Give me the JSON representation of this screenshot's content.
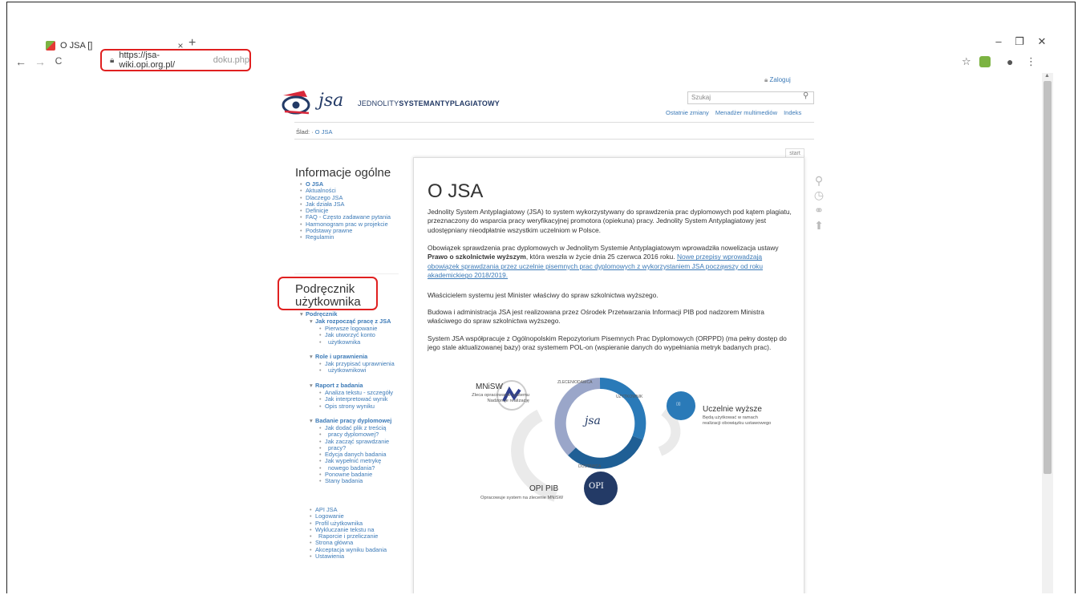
{
  "browser": {
    "tab_title": "O JSA []",
    "tab_close": "×",
    "new_tab": "+",
    "url_host": "https://jsa-wiki.opi.org.pl/",
    "url_path": "doku.php",
    "minimize": "–",
    "restore": "❐",
    "close": "✕",
    "back": "←",
    "forward": "→",
    "reload": "C",
    "star": "☆",
    "profile": "●",
    "menu": "⋮"
  },
  "header": {
    "login": "Zaloguj",
    "logo_text": "jsa",
    "tagline_light": "JEDNOLITY",
    "tagline_bold1": "SYSTEM",
    "tagline_bold2": "ANTYPLAGIATOWY",
    "search_placeholder": "Szukaj",
    "links": [
      "Ostatnie zmiany",
      "Menadżer multimediów",
      "Indeks"
    ]
  },
  "breadcrumb": {
    "label": "Ślad:",
    "item": "O JSA"
  },
  "sidebar": {
    "section1_title": "Informacje ogólne",
    "section1_items": [
      "O JSA",
      "Aktualności",
      "Dlaczego JSA",
      "Jak działa JSA",
      "Definicje",
      "FAQ - Często zadawane pytania",
      "Harmonogram prac w projekcie",
      "Podstawy prawne",
      "Regulamin"
    ],
    "section2_title_l1": "Podręcznik",
    "section2_title_l2": "użytkownika",
    "tree": {
      "root": "Podręcznik",
      "g1": "Jak rozpocząć pracę z JSA",
      "g1_items": [
        "Pierwsze logowanie",
        "Jak utworzyć konto",
        "użytkownika"
      ],
      "g2": "Role i uprawnienia",
      "g2_items": [
        "Jak przypisać uprawnienia",
        "użytkownikowi"
      ],
      "g3": "Raport z badania",
      "g3_items": [
        "Analiza tekstu - szczegóły",
        "Jak interpretować wynik",
        "Opis strony wyniku"
      ],
      "g4": "Badanie pracy dyplomowej",
      "g4_items": [
        "Jak dodać plik z treścią",
        "pracy dyplomowej?",
        "Jak zacząć sprawdzanie",
        "pracy?",
        "Edycja danych badania",
        "Jak wypełnić metrykę",
        "nowego badania?",
        "Ponowne badanie",
        "Stany badania"
      ],
      "rest": [
        "API JSA",
        "Logowanie",
        "Profil użytkownika",
        "Wykluczanie tekstu na",
        "Raporcie i przeliczanie",
        "Strona główna",
        "Akceptacja wyniku badania",
        "Ustawienia"
      ]
    }
  },
  "content": {
    "tab": "start",
    "title": "O JSA",
    "p1": "Jednolity System Antyplagiatowy (JSA) to system wykorzystywany do sprawdzenia prac dyplomowych pod kątem plagiatu, przeznaczony do wsparcia pracy weryfikacyjnej promotora (opiekuna) pracy. Jednolity System Antyplagiatowy jest udostępniany nieodpłatnie wszystkim uczelniom w Polsce.",
    "p2_a": "Obowiązek sprawdzenia prac dyplomowych w Jednolitym Systemie Antyplagiatowym wprowadziła nowelizacja ustawy ",
    "p2_bold": "Prawo o szkolnictwie wyższym",
    "p2_b": ", która weszła w życie dnia 25 czerwca 2016 roku. ",
    "p2_link": "Nowe przepisy wprowadzają obowiązek sprawdzania przez uczelnie pisemnych prac dyplomowych z wykorzystaniem JSA począwszy od roku akademickiego 2018/2019.",
    "p3": "Właścicielem systemu jest Minister właściwy do spraw szkolnictwa wyższego.",
    "p4": "Budowa i administracja JSA jest realizowana przez Ośrodek Przetwarzania Informacji PIB pod nadzorem Ministra właściwego do spraw szkolnictwa wyższego.",
    "p5": "System JSA współpracuje z Ogólnopolskim Repozytorium Pisemnych Prac Dyplomowych (ORPPD) (ma pełny dostęp do jego stale aktualizowanej bazy) oraz systemem POL-on (wspieranie danych do wypełniania metryk badanych prac)."
  },
  "diagram": {
    "mnisw": "MNiSW",
    "mnisw_sub1": "Zleca opracowanie systemu",
    "mnisw_sub2": "Nadzoruje realizację",
    "zlecen": "ZLECENIODAWCA",
    "uzytk": "UŻYTKOWNIK",
    "dostawca": "DOSTAWCA",
    "center": "jsa",
    "uczelnie": "Uczelnie wyższe",
    "uczelnie_sub1": "Będą użytkować w ramach",
    "uczelnie_sub2": "realizacji obowiązku ustawowego",
    "opi": "OPI PIB",
    "opi_sub": "Opracowuje system na zlecenie MNiSW",
    "opi_logo": "OPI"
  },
  "colors": {
    "brand_navy": "#233a66",
    "link": "#3c7ab7",
    "highlight": "#e02020",
    "ring": "#2a7ab8"
  }
}
